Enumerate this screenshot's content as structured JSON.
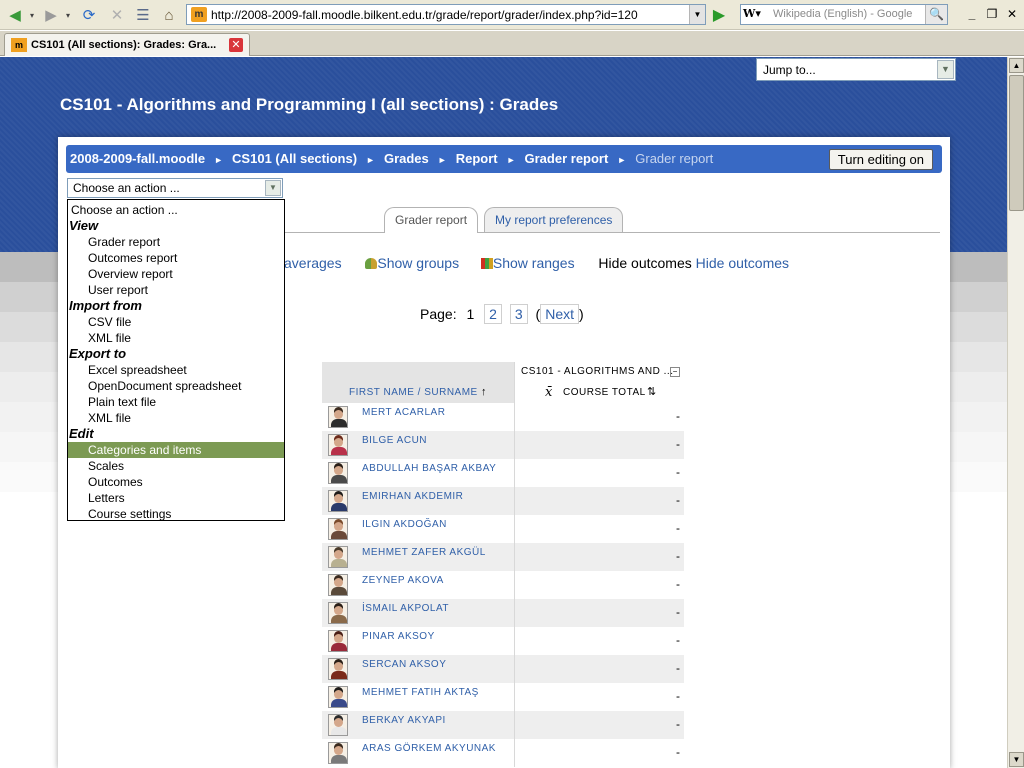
{
  "browser": {
    "url": "http://2008-2009-fall.moodle.bilkent.edu.tr/grade/report/grader/index.php?id=120",
    "search_placeholder": "Wikipedia (English) - Google",
    "tab_title": "CS101 (All sections): Grades: Gra..."
  },
  "header": {
    "title": "CS101 - Algorithms and Programming I (all sections) : Grades",
    "jump_to": "Jump to..."
  },
  "breadcrumb": {
    "items": [
      "2008-2009-fall.moodle",
      "CS101 (All sections)",
      "Grades",
      "Report",
      "Grader report"
    ],
    "current": "Grader report",
    "separator": "►"
  },
  "editing_button": "Turn editing on",
  "action_select": {
    "value": "Choose an action ...",
    "options": [
      {
        "label": "Choose an action ...",
        "type": "option"
      },
      {
        "label": "View",
        "type": "group"
      },
      {
        "label": "Grader report",
        "type": "item"
      },
      {
        "label": "Outcomes report",
        "type": "item"
      },
      {
        "label": "Overview report",
        "type": "item"
      },
      {
        "label": "User report",
        "type": "item"
      },
      {
        "label": "Import from",
        "type": "group"
      },
      {
        "label": "CSV file",
        "type": "item"
      },
      {
        "label": "XML file",
        "type": "item"
      },
      {
        "label": "Export to",
        "type": "group"
      },
      {
        "label": "Excel spreadsheet",
        "type": "item"
      },
      {
        "label": "OpenDocument spreadsheet",
        "type": "item"
      },
      {
        "label": "Plain text file",
        "type": "item"
      },
      {
        "label": "XML file",
        "type": "item"
      },
      {
        "label": "Edit",
        "type": "group"
      },
      {
        "label": "Categories and items",
        "type": "item",
        "selected": true
      },
      {
        "label": "Scales",
        "type": "item"
      },
      {
        "label": "Outcomes",
        "type": "item"
      },
      {
        "label": "Letters",
        "type": "item"
      },
      {
        "label": "Course settings",
        "type": "item"
      }
    ]
  },
  "report_tabs": [
    "Grader report",
    "My report preferences"
  ],
  "toggles": {
    "averages": "averages",
    "show_groups": "Show groups",
    "show_ranges": "Show ranges",
    "hide_outcomes_text": "Hide outcomes",
    "hide_outcomes_link": "Hide outcomes"
  },
  "paging": {
    "label": "Page:",
    "current": "1",
    "pages": [
      "2",
      "3"
    ],
    "next": "Next"
  },
  "grader": {
    "category_header": "CS101 - ALGORITHMS AND ...",
    "name_header_first": "FIRST NAME",
    "name_header_sep": " / ",
    "name_header_last": "SURNAME",
    "sort_up_icon": "↑",
    "total_symbol": "x̄",
    "total_header": "COURSE TOTAL",
    "sort_icon": "⇅",
    "students": [
      {
        "name": "MERT ACARLAR",
        "grade": "-",
        "hair": "#3b2a1e",
        "shirt": "#2c2c2c"
      },
      {
        "name": "BILGE ACUN",
        "grade": "-",
        "hair": "#6b2a1a",
        "shirt": "#b8314a"
      },
      {
        "name": "ABDULLAH BAŞAR AKBAY",
        "grade": "-",
        "hair": "#2a1e16",
        "shirt": "#4a4a4a"
      },
      {
        "name": "EMIRHAN AKDEMIR",
        "grade": "-",
        "hair": "#1e1a18",
        "shirt": "#2a3a6a"
      },
      {
        "name": "ILGIN AKDOĞAN",
        "grade": "-",
        "hair": "#7a4a2a",
        "shirt": "#6a4a3a"
      },
      {
        "name": "MEHMET ZAFER AKGÜL",
        "grade": "-",
        "hair": "#4a3a2a",
        "shirt": "#b8b090"
      },
      {
        "name": "ZEYNEP AKOVA",
        "grade": "-",
        "hair": "#3a2a1e",
        "shirt": "#5a4a3a"
      },
      {
        "name": "İSMAIL AKPOLAT",
        "grade": "-",
        "hair": "#2a1e16",
        "shirt": "#8a6a4a"
      },
      {
        "name": "PINAR AKSOY",
        "grade": "-",
        "hair": "#4a1e16",
        "shirt": "#9a2a3a"
      },
      {
        "name": "SERCAN AKSOY",
        "grade": "-",
        "hair": "#2a1e16",
        "shirt": "#7a2a1a"
      },
      {
        "name": "MEHMET FATIH AKTAŞ",
        "grade": "-",
        "hair": "#1e1a18",
        "shirt": "#3a4a8a"
      },
      {
        "name": "BERKAY AKYAPI",
        "grade": "-",
        "hair": "#2a2a2a",
        "shirt": "#e8e8e8"
      },
      {
        "name": "ARAS GÖRKEM AKYUNAK",
        "grade": "-",
        "hair": "#3a2a1e",
        "shirt": "#7a7a7a"
      }
    ]
  },
  "colors": {
    "header_blue": "#2a4f9c",
    "navbar_blue": "#3869c4",
    "link_blue": "#2f5fa8",
    "selected_option": "#7c9a53",
    "row_alt": "#eeeeee"
  }
}
